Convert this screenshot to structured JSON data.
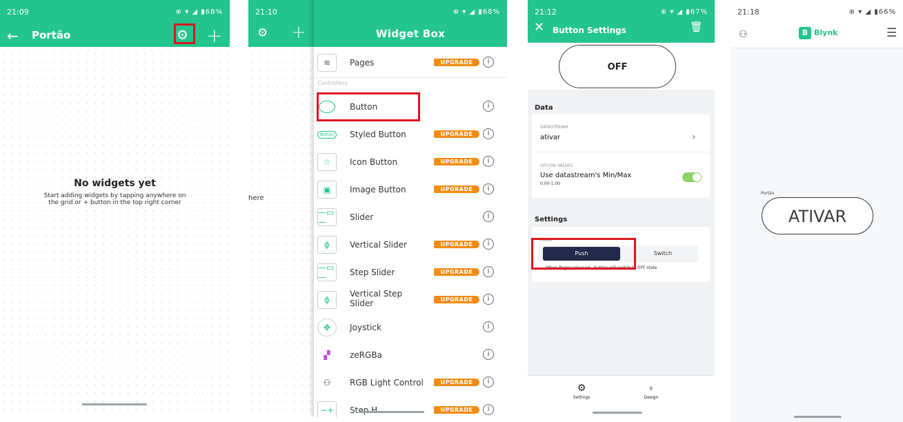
{
  "screen1": {
    "status_time": "21:09",
    "status_icons": "⊕ ▾ ◢ ▮68%",
    "title": "Portão",
    "empty_title": "No widgets yet",
    "empty_text": "Start adding widgets by tapping anywhere on the grid or + button in the top right corner"
  },
  "screen2": {
    "status_time": "21:10",
    "status_icons": "⊕ ▾ ◢ ▮68%",
    "background_fragment": "here",
    "panel_title": "Widget Box",
    "section_label": "Controllers",
    "upgrade_label": "UPGRADE",
    "widgets": [
      {
        "label": "Pages",
        "icon": "pages-icon",
        "upgrade": true
      },
      {
        "label": "Button",
        "icon": "button-icon",
        "upgrade": false
      },
      {
        "label": "Styled Button",
        "icon": "styled-button-icon",
        "upgrade": true
      },
      {
        "label": "Icon Button",
        "icon": "icon-button-icon",
        "upgrade": true
      },
      {
        "label": "Image Button",
        "icon": "image-button-icon",
        "upgrade": true
      },
      {
        "label": "Slider",
        "icon": "slider-icon",
        "upgrade": false
      },
      {
        "label": "Vertical Slider",
        "icon": "vertical-slider-icon",
        "upgrade": true
      },
      {
        "label": "Step Slider",
        "icon": "step-slider-icon",
        "upgrade": true
      },
      {
        "label": "Vertical Step Slider",
        "icon": "vertical-step-slider-icon",
        "upgrade": true
      },
      {
        "label": "Joystick",
        "icon": "joystick-icon",
        "upgrade": false
      },
      {
        "label": "zeRGBa",
        "icon": "zergba-icon",
        "upgrade": false
      },
      {
        "label": "RGB Light Control",
        "icon": "rgb-light-icon",
        "upgrade": true
      },
      {
        "label": "Step H",
        "icon": "step-h-icon",
        "upgrade": true
      }
    ]
  },
  "screen3": {
    "status_time": "21:12",
    "status_icons": "⊕ ▾ ◢ ▮67%",
    "title": "Button Settings",
    "preview_label": "OFF",
    "data_section": "Data",
    "datastream_label": "DATASTREAM",
    "datastream_value": "ativar",
    "offon_label": "OFF/ON VALUES",
    "offon_value": "Use datastream's Min/Max",
    "offon_range": "0.00-1.00",
    "settings_section": "Settings",
    "mode_label": "MODE",
    "mode_push": "Push",
    "mode_switch": "Switch",
    "mode_hint": "When finger released - button will switch to OFF state",
    "tab_settings": "Settings",
    "tab_design": "Design"
  },
  "screen4": {
    "status_time": "21:18",
    "status_icons": "⊕ ▾ ◢ ▮66%",
    "logo_text": "Blynk",
    "logo_letter": "B",
    "widget_label": "Portão",
    "button_label": "ATIVAR"
  },
  "colors": {
    "accent_green": "#23c48e",
    "highlight_red": "#e0141c",
    "upgrade_orange": "#f28b13",
    "push_navy": "#22294a"
  }
}
